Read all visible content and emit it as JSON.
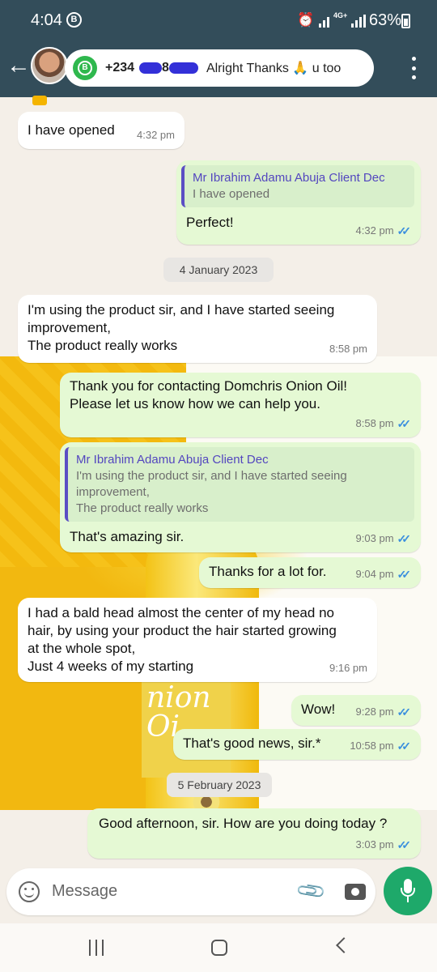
{
  "status_bar": {
    "time": "4:04",
    "b_icon": "B",
    "network": "4G+",
    "battery": "63%"
  },
  "header": {
    "back_icon": "←",
    "business_icon": "B",
    "phone_prefix": "+234",
    "phone_mid": "8",
    "last_message": "Alright  Thanks 🙏 u too"
  },
  "messages": [
    {
      "type": "in",
      "text": "I have opened",
      "time": "4:32 pm"
    },
    {
      "type": "out",
      "quote_author": "Mr Ibrahim Adamu Abuja Client Dec",
      "quote_text": "I have opened",
      "text": "Perfect!",
      "time": "4:32 pm"
    },
    {
      "type": "date",
      "text": "4 January 2023"
    },
    {
      "type": "in",
      "text": "I'm using the product sir, and I have started seeing\nimprovement,\nThe product really works",
      "time": "8:58 pm"
    },
    {
      "type": "out",
      "text": "Thank you for contacting Domchris Onion Oil!\nPlease let us know how we can help you.",
      "time": "8:58 pm"
    },
    {
      "type": "out",
      "quote_author": "Mr Ibrahim Adamu Abuja Client Dec",
      "quote_text": "I'm using the product sir, and I have started seeing\nimprovement,\nThe product really works",
      "text": "That's amazing sir.",
      "time": "9:03 pm"
    },
    {
      "type": "out",
      "text": "Thanks for a lot for.",
      "time": "9:04 pm"
    },
    {
      "type": "in",
      "text": "I had a bald head almost the center of my head no\nhair, by using your product the hair started growing\nat the whole spot,\nJust 4 weeks of my starting",
      "time": "9:16 pm"
    },
    {
      "type": "out",
      "text": "Wow!",
      "time": "9:28 pm"
    },
    {
      "type": "out",
      "text": "That's good news, sir.*",
      "time": "10:58 pm"
    },
    {
      "type": "date",
      "text": "5 February 2023"
    },
    {
      "type": "out",
      "text": "Good afternoon, sir. How are you doing today ?",
      "time": "3:03 pm"
    }
  ],
  "photo_text": "nion\nOi",
  "input": {
    "placeholder": "Message"
  }
}
